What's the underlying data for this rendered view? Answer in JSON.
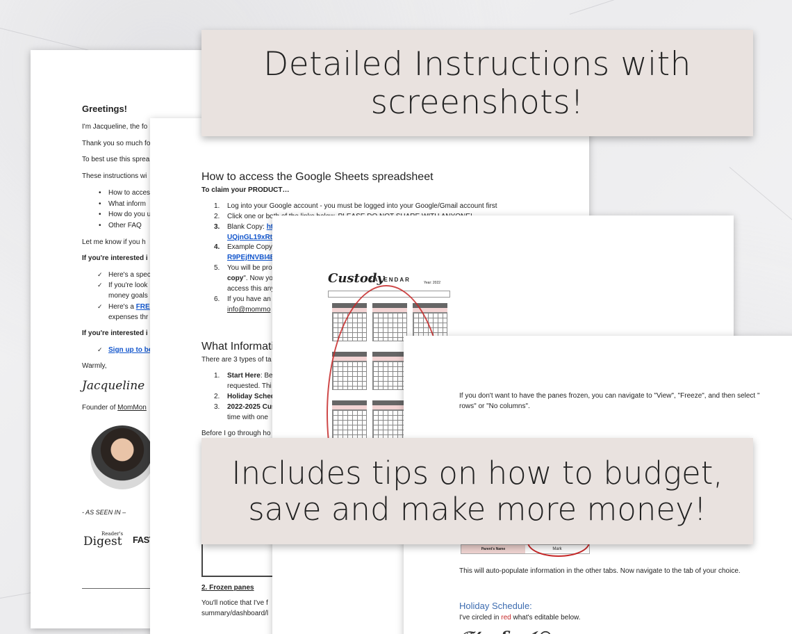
{
  "banners": {
    "top": "Detailed Instructions with screenshots!",
    "bottom": "Includes tips on how to budget, save and make more money!"
  },
  "page1": {
    "greeting": "Greetings!",
    "lines": [
      "I'm Jacqueline, the fo",
      "Thank you so much fo",
      "To best use this sprea",
      "These instructions wi"
    ],
    "bullets": [
      "How to acces",
      "What inform",
      "How do you u",
      "Other FAQ"
    ],
    "let_me_know": "Let me know if you h",
    "interested_1": "If you're interested i",
    "checks": [
      "Here's a spec",
      "If you're look",
      "money goals",
      "Here's a "
    ],
    "free_link": "FRE",
    "expenses": "expenses thr",
    "interested_2": "If you're interested i",
    "signup": "Sign up to be",
    "warmly": "Warmly,",
    "signature": "Jacqueline",
    "founder": "Founder of ",
    "founder_link": "MomMon",
    "as_seen_in": "- AS SEEN IN –",
    "logo_rd_1": "Reader's",
    "logo_rd_2": "Digest",
    "logo_fc": "FAST"
  },
  "page2": {
    "heading": "How to access the Google Sheets spreadsheet",
    "subheading": "To claim your PRODUCT…",
    "steps": [
      {
        "num": "1.",
        "text": "Log into your Google account - you must be logged into your Google/Gmail account first"
      },
      {
        "num": "2.",
        "text": "Click one or both of the links below. PLEASE DO NOT SHARE WITH ANYONE!"
      },
      {
        "num": "3.",
        "text": "Blank Copy: "
      },
      {
        "num": "4.",
        "text": "Example Copy"
      },
      {
        "num": "5.",
        "text": "You will be pro"
      },
      {
        "num": "6.",
        "text": "If you have an"
      }
    ],
    "step3_link": "htt",
    "step3_link2": "UQjnGL19xRtk",
    "step4_link": "R9PEjfNVBI4B",
    "step5_copy": "copy",
    "step5_cont": "\". Now yo",
    "step5_line3": "access this any",
    "step6_email": "info@mommo",
    "what_info": "What Informati",
    "types": "There are 3 types of ta",
    "list": [
      {
        "num": "1.",
        "bold": "Start Here",
        "text": ": Be"
      },
      {
        "num": "",
        "bold": "",
        "text": "requested. Thi"
      },
      {
        "num": "2.",
        "bold": "Holiday Sched",
        "text": ""
      },
      {
        "num": "3.",
        "bold": "2022-2025 Cus",
        "text": ""
      },
      {
        "num": "",
        "bold": "",
        "text": "time with one"
      }
    ],
    "before": "Before I go through ho",
    "frozen": "2. Frozen panes",
    "notice": "You'll notice that I've f",
    "summary": "summary/dashboard/l"
  },
  "page3": {
    "cal_title": "Custody",
    "cal_sub": "CALENDAR",
    "cal_year": "Year: 2022"
  },
  "page4": {
    "freeze_1": "If you don't want to have the panes frozen, you can navigate to \"View\", \"Freeze\", and then select \"",
    "freeze_2": "rows\" or \"No columns\".",
    "parent_label": "Parent's Name",
    "parent_value": "Mark",
    "auto": "This will auto-populate information in the other tabs. Now navigate to the tab of your choice.",
    "holiday": "Holiday Schedule:",
    "circled_pre": "I've circled in ",
    "circled_red": "red",
    "circled_post": " what's editable below."
  },
  "colors": {
    "banner_bg": "#e9e2df",
    "link": "#1155cc",
    "red": "#c62828",
    "heading_blue": "#3d6cb0"
  }
}
